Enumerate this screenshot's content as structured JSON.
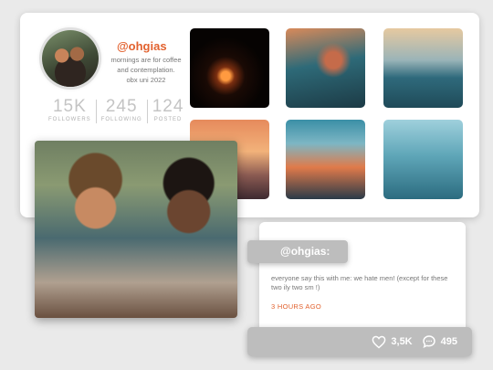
{
  "profile": {
    "handle": "@ohgias",
    "bio": [
      "mornings are for coffee",
      "and contemplation.",
      "obx uni 2022"
    ],
    "stats": [
      {
        "value": "15K",
        "label": "FOLLOWERS"
      },
      {
        "value": "245",
        "label": "FOLLOWING"
      },
      {
        "value": "124",
        "label": "POSTED"
      }
    ]
  },
  "post": {
    "handle": "@ohgias:",
    "text": "everyone say this with me: we hate men! (except for these two ily two sm !)",
    "time": "3 HOURS AGO",
    "likes": "3,5K",
    "comments": "495"
  },
  "colors": {
    "accent": "#e2622f",
    "pill": "#bdbdbd"
  }
}
